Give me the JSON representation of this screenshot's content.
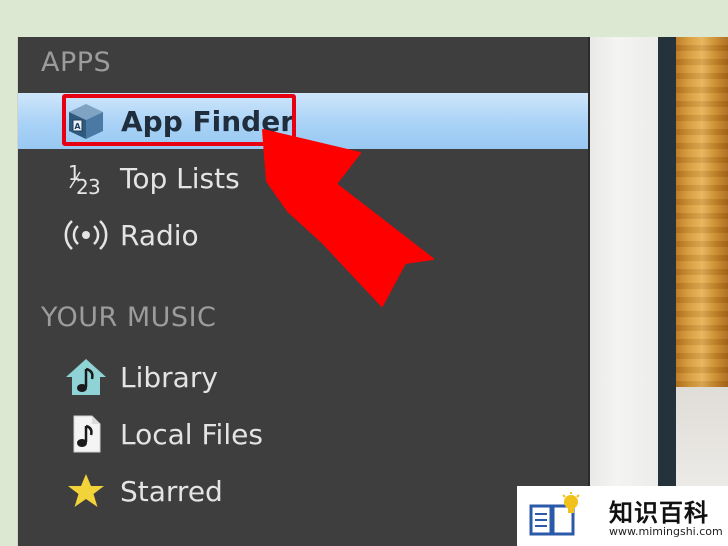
{
  "sidebar": {
    "apps_header": "APPS",
    "music_header": "YOUR MUSIC",
    "apps_items": [
      {
        "label": "App Finder",
        "icon": "app-finder-icon",
        "selected": true
      },
      {
        "label": "Top Lists",
        "icon": "top-lists-icon",
        "selected": false
      },
      {
        "label": "Radio",
        "icon": "radio-icon",
        "selected": false
      }
    ],
    "music_items": [
      {
        "label": "Library",
        "icon": "library-icon"
      },
      {
        "label": "Local Files",
        "icon": "local-files-icon"
      },
      {
        "label": "Starred",
        "icon": "star-icon"
      }
    ]
  },
  "colors": {
    "selected_bg": "#a9d2f6",
    "highlight": "#e60012",
    "arrow": "#ff0000",
    "sidebar_bg": "#3e3e3e"
  },
  "watermark": {
    "title": "知识百科",
    "url": "www.mimingshi.com"
  }
}
